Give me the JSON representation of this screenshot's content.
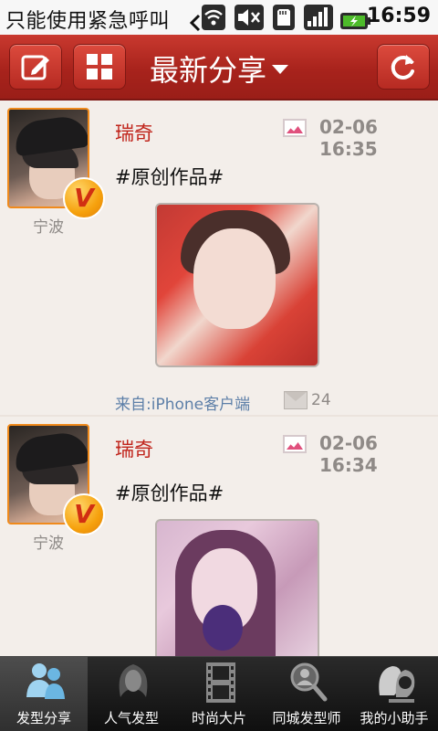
{
  "status_bar": {
    "notification": "只能使用紧急呼叫",
    "time": "16:59",
    "icons": [
      "wifi-icon",
      "mute-icon",
      "sdcard-icon",
      "signal-icon",
      "battery-icon"
    ]
  },
  "header": {
    "title": "最新分享",
    "left_buttons": [
      "compose-icon",
      "grid-icon"
    ],
    "right_button": "refresh-icon"
  },
  "posts": [
    {
      "username": "瑞奇",
      "city": "宁波",
      "time": "02-06 16:35",
      "text": "#原创作品#",
      "source": "来自:iPhone客户端",
      "comments": "24"
    },
    {
      "username": "瑞奇",
      "city": "宁波",
      "time": "02-06 16:34",
      "text": "#原创作品#"
    }
  ],
  "badge": "V",
  "tabs": [
    {
      "label": "发型分享",
      "active": true
    },
    {
      "label": "人气发型",
      "active": false
    },
    {
      "label": "时尚大片",
      "active": false
    },
    {
      "label": "同城发型师",
      "active": false
    },
    {
      "label": "我的小助手",
      "active": false
    }
  ],
  "colors": {
    "header_red": "#a8231c",
    "username_red": "#c0241b",
    "link_blue": "#5d7fa8",
    "badge_orange": "#f6a10d"
  }
}
